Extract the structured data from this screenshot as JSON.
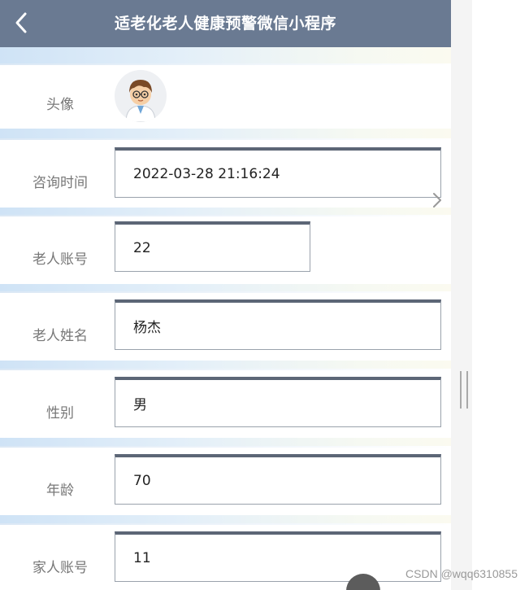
{
  "nav": {
    "title": "适老化老人健康预警微信小程序",
    "back_icon": "chevron-left-icon"
  },
  "form": {
    "avatar": {
      "label": "头像",
      "icon": "cartoon-doctor-avatar"
    },
    "fields": [
      {
        "key": "consult_time",
        "label": "咨询时间",
        "value": "2022-03-28 21:16:24"
      },
      {
        "key": "elder_account",
        "label": "老人账号",
        "value": "22",
        "has_picker": true,
        "picker_icon": "chevron-right-icon"
      },
      {
        "key": "elder_name",
        "label": "老人姓名",
        "value": "杨杰"
      },
      {
        "key": "gender",
        "label": "性别",
        "value": "男"
      },
      {
        "key": "age",
        "label": "年龄",
        "value": "70"
      },
      {
        "key": "family_account",
        "label": "家人账号",
        "value": "11"
      }
    ]
  },
  "watermark": "CSDN @wqq6310855",
  "colors": {
    "nav_bg": "#6a7a92",
    "input_top_border": "#5c6676",
    "band_blue": "#cfe3f6"
  }
}
